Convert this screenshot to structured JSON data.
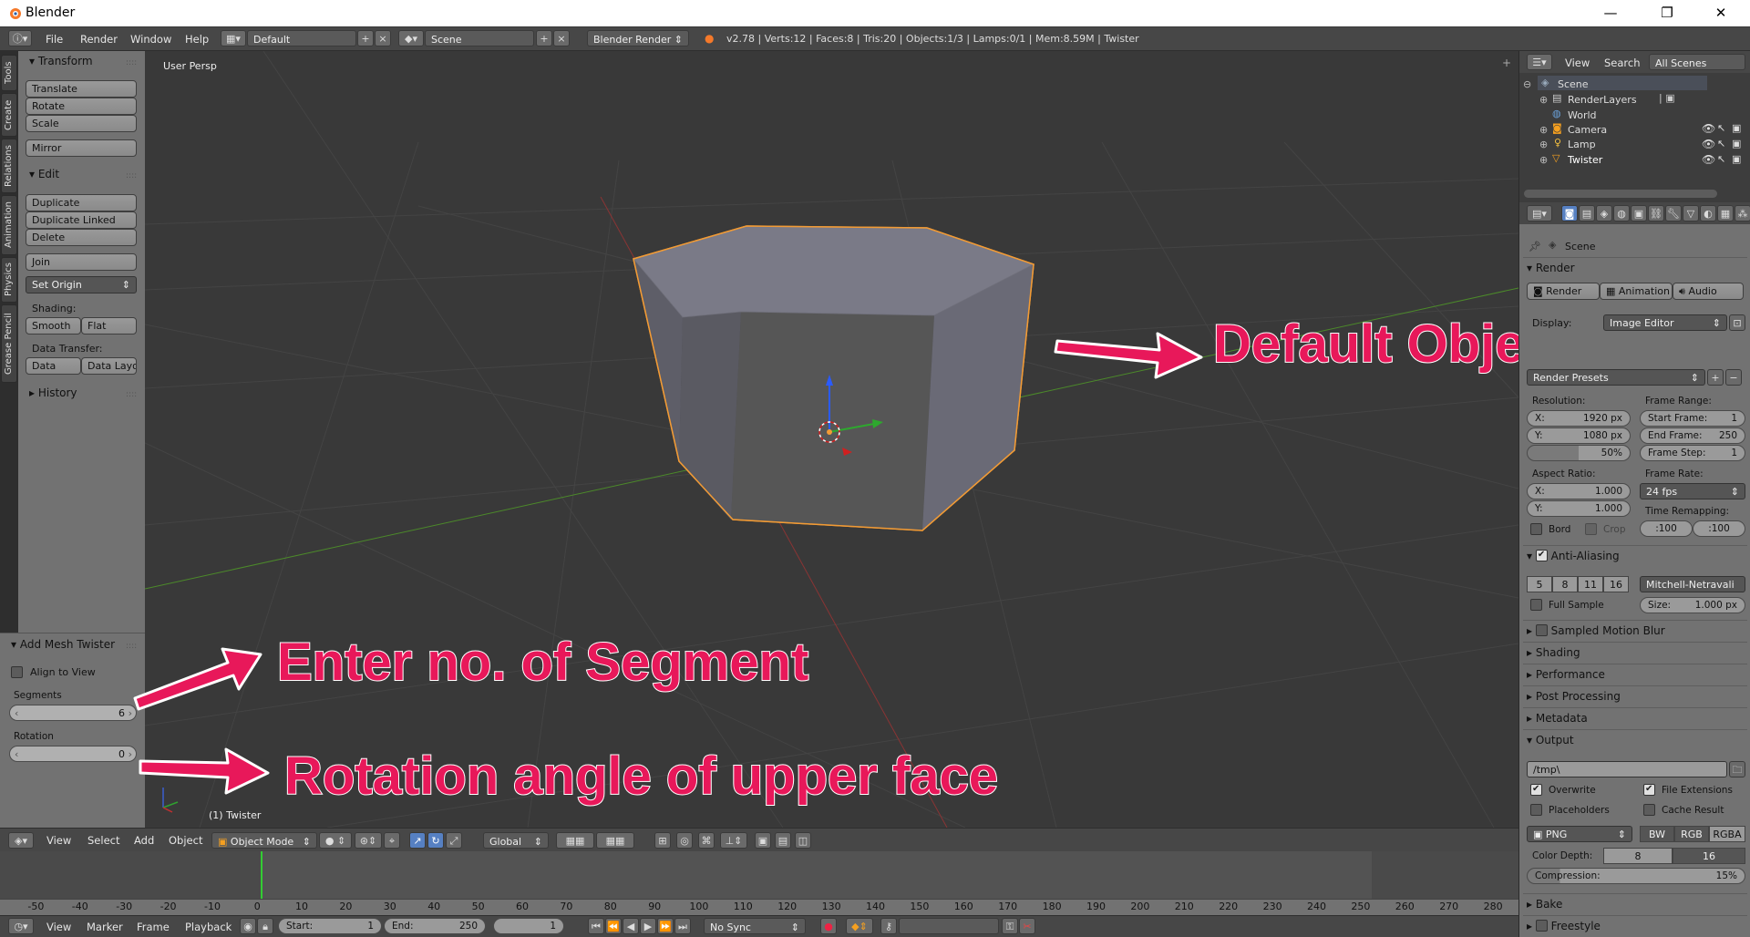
{
  "window": {
    "title": "Blender",
    "min": "—",
    "max": "❐",
    "close": "✕"
  },
  "topbar": {
    "menus": [
      "File",
      "Render",
      "Window",
      "Help"
    ],
    "layout": "Default",
    "scene": "Scene",
    "engine": "Blender Render",
    "stats": "v2.78 | Verts:12 | Faces:8 | Tris:20 | Objects:1/3 | Lamps:0/1 | Mem:8.59M | Twister"
  },
  "vtabs": [
    "Tools",
    "Create",
    "Relations",
    "Animation",
    "Physics",
    "Grease Pencil"
  ],
  "tools": {
    "transform_title": "Transform",
    "translate": "Translate",
    "rotate": "Rotate",
    "scale": "Scale",
    "mirror": "Mirror",
    "edit_title": "Edit",
    "duplicate": "Duplicate",
    "duplicate_linked": "Duplicate Linked",
    "delete": "Delete",
    "join": "Join",
    "set_origin": "Set Origin",
    "shading_label": "Shading:",
    "smooth": "Smooth",
    "flat": "Flat",
    "data_transfer_label": "Data Transfer:",
    "data": "Data",
    "data_layo": "Data Layo",
    "history_title": "History"
  },
  "redo": {
    "title": "Add Mesh Twister",
    "align_to_view": "Align to View",
    "segments_label": "Segments",
    "segments_value": "6",
    "rotation_label": "Rotation",
    "rotation_value": "0"
  },
  "viewport": {
    "persp_label": "User Persp",
    "object_label": "(1) Twister"
  },
  "annotations": {
    "default_object": "Default Object",
    "segments": "Enter no. of Segment",
    "rotation": "Rotation angle of upper face"
  },
  "header3d": {
    "menus": [
      "View",
      "Select",
      "Add",
      "Object"
    ],
    "mode": "Object Mode",
    "orientation": "Global"
  },
  "timeline": {
    "ticks": [
      "-50",
      "-40",
      "-30",
      "-20",
      "-10",
      "0",
      "10",
      "20",
      "30",
      "40",
      "50",
      "60",
      "70",
      "80",
      "90",
      "100",
      "110",
      "120",
      "130",
      "140",
      "150",
      "160",
      "170",
      "180",
      "190",
      "200",
      "210",
      "220",
      "230",
      "240",
      "250",
      "260",
      "270",
      "280"
    ],
    "menus": [
      "View",
      "Marker",
      "Frame",
      "Playback"
    ],
    "start_label": "Start:",
    "start_value": "1",
    "end_label": "End:",
    "end_value": "250",
    "current": "1",
    "sync": "No Sync"
  },
  "outliner": {
    "view": "View",
    "search": "Search",
    "filter": "All Scenes",
    "items": [
      "Scene",
      "RenderLayers",
      "World",
      "Camera",
      "Lamp",
      "Twister"
    ]
  },
  "props": {
    "context": "Scene",
    "render_title": "Render",
    "render_btn": "Render",
    "animation_btn": "Animation",
    "audio_btn": "Audio",
    "display_label": "Display:",
    "display_value": "Image Editor",
    "presets": "Render Presets",
    "resolution_label": "Resolution:",
    "res_x": "X:",
    "res_x_val": "1920 px",
    "res_y": "Y:",
    "res_y_val": "1080 px",
    "res_pct": "50%",
    "frame_range_label": "Frame Range:",
    "start_frame": "Start Frame:",
    "start_frame_val": "1",
    "end_frame": "End Frame:",
    "end_frame_val": "250",
    "frame_step": "Frame Step:",
    "frame_step_val": "1",
    "aspect_label": "Aspect Ratio:",
    "asp_x": "X:",
    "asp_x_val": "1.000",
    "asp_y": "Y:",
    "asp_y_val": "1.000",
    "frame_rate_label": "Frame Rate:",
    "fps": "24 fps",
    "time_remap_label": "Time Remapping:",
    "remap_old": ":100",
    "remap_new": ":100",
    "bord": "Bord",
    "crop": "Crop",
    "aa_title": "Anti-Aliasing",
    "aa_samples": [
      "5",
      "8",
      "11",
      "16"
    ],
    "aa_filter": "Mitchell-Netravali",
    "full_sample": "Full Sample",
    "size_label": "Size:",
    "size_val": "1.000 px",
    "smb": "Sampled Motion Blur",
    "shading": "Shading",
    "performance": "Performance",
    "post": "Post Processing",
    "metadata": "Metadata",
    "output_title": "Output",
    "output_path": "/tmp\\",
    "overwrite": "Overwrite",
    "file_ext": "File Extensions",
    "placeholders": "Placeholders",
    "cache_result": "Cache Result",
    "format": "PNG",
    "bw": "BW",
    "rgb": "RGB",
    "rgba": "RGBA",
    "color_depth_label": "Color Depth:",
    "depth8": "8",
    "depth16": "16",
    "compression_label": "Compression:",
    "compression_val": "15%",
    "bake": "Bake",
    "freestyle": "Freestyle"
  },
  "colors": {
    "accent": "#5680c2",
    "annotation": "#e8185a",
    "selection": "#f29b35"
  }
}
